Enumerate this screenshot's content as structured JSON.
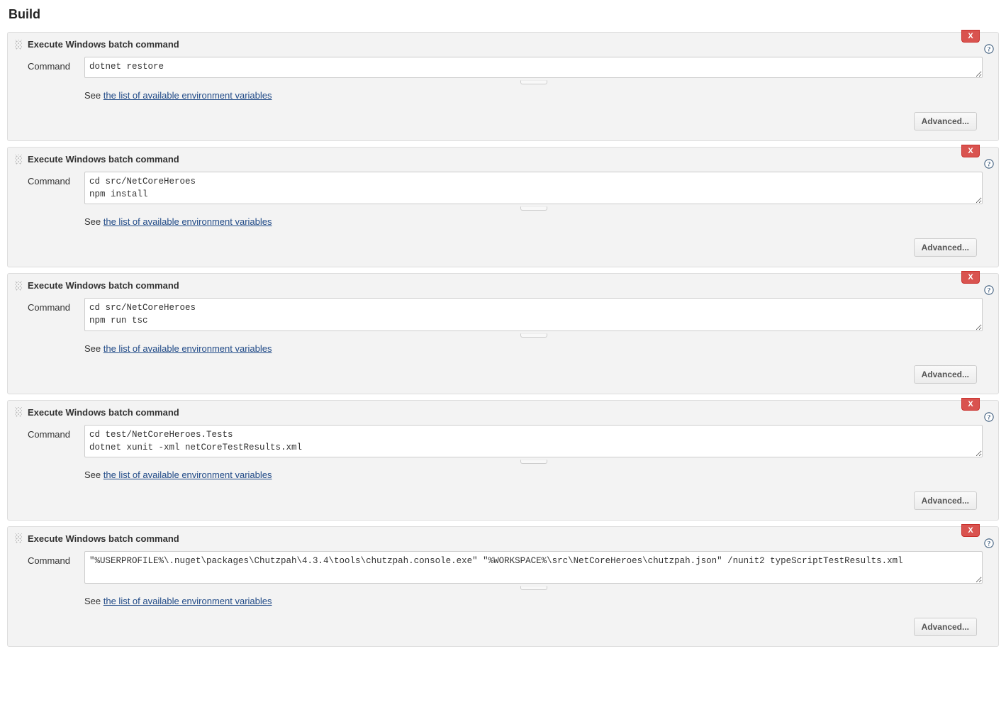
{
  "section_title": "Build",
  "common": {
    "step_title": "Execute Windows batch command",
    "field_label": "Command",
    "hint_prefix": "See ",
    "hint_link_text": "the list of available environment variables",
    "advanced_label": "Advanced...",
    "remove_label": "X"
  },
  "steps": [
    {
      "command": "dotnet restore",
      "rows": 1
    },
    {
      "command": "cd src/NetCoreHeroes\nnpm install",
      "rows": 2
    },
    {
      "command": "cd src/NetCoreHeroes\nnpm run tsc",
      "rows": 2
    },
    {
      "command": "cd test/NetCoreHeroes.Tests\ndotnet xunit -xml netCoreTestResults.xml",
      "rows": 2
    },
    {
      "command": "\"%USERPROFILE%\\.nuget\\packages\\Chutzpah\\4.3.4\\tools\\chutzpah.console.exe\" \"%WORKSPACE%\\src\\NetCoreHeroes\\chutzpah.json\" /nunit2 typeScriptTestResults.xml",
      "rows": 2
    }
  ]
}
